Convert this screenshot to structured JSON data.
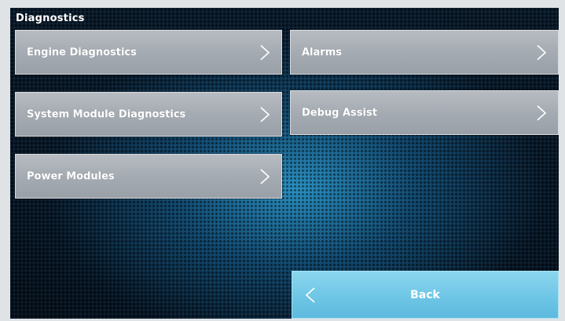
{
  "header": {
    "title": "Diagnostics"
  },
  "menu": {
    "engine_diagnostics": "Engine Diagnostics",
    "alarms": "Alarms",
    "system_module_diagnostics": "System Module Diagnostics",
    "debug_assist": "Debug Assist",
    "power_modules": "Power Modules"
  },
  "footer": {
    "back_label": "Back"
  },
  "icons": {
    "forward": "chevron-right-icon",
    "back": "chevron-left-icon"
  },
  "colors": {
    "button_gray": "#a5abb2",
    "back_button": "#6fc6e6",
    "background_glow": "#2ca0d7",
    "background_dark": "#06111c"
  }
}
